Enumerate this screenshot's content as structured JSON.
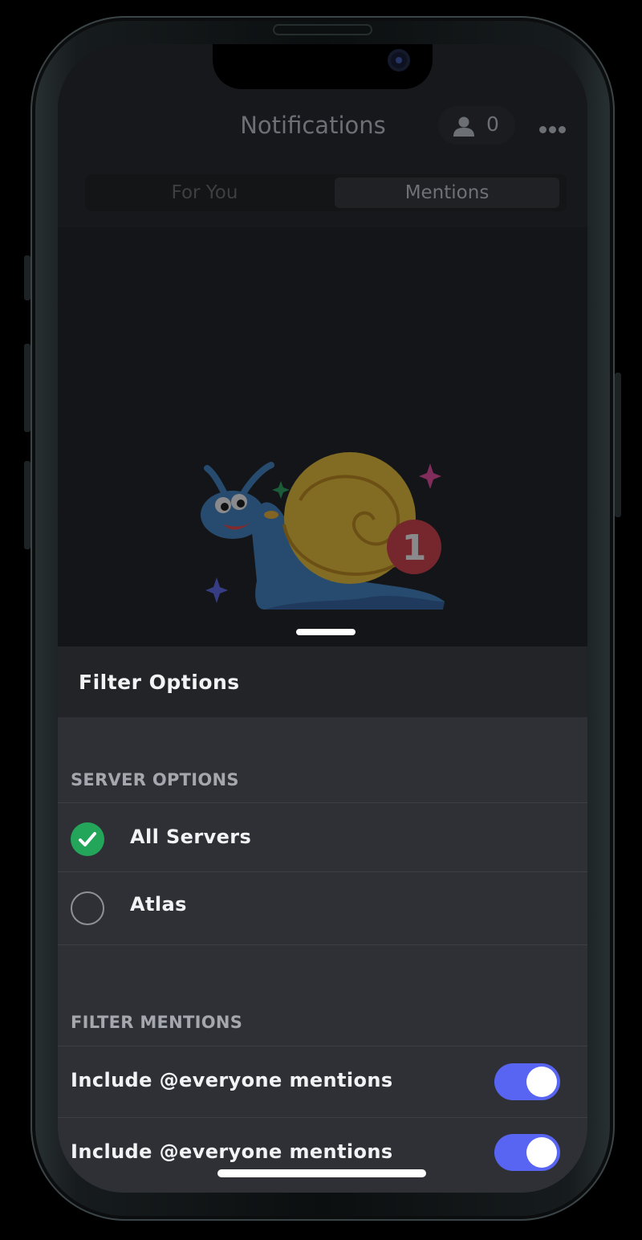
{
  "header": {
    "title": "Notifications",
    "friend_count": "0",
    "person_icon": "person-icon",
    "more_icon": "more-horizontal-icon"
  },
  "tabs": [
    {
      "label": "For You",
      "active": false
    },
    {
      "label": "Mentions",
      "active": true
    }
  ],
  "illustration": {
    "name": "snail-illustration",
    "badge": "1"
  },
  "sheet": {
    "title": "Filter Options",
    "server_section_label": "SERVER OPTIONS",
    "servers": [
      {
        "label": "All Servers",
        "selected": true
      },
      {
        "label": "Atlas",
        "selected": false
      }
    ],
    "mentions_section_label": "FILTER MENTIONS",
    "mention_filters": [
      {
        "label": "Include @everyone mentions",
        "enabled": true
      },
      {
        "label": "Include @everyone mentions",
        "enabled": true
      }
    ]
  },
  "colors": {
    "accent_toggle": "#5865f2",
    "check_green": "#23a55a",
    "sheet_bg": "#2f3035",
    "badge_red": "#d83a42"
  }
}
